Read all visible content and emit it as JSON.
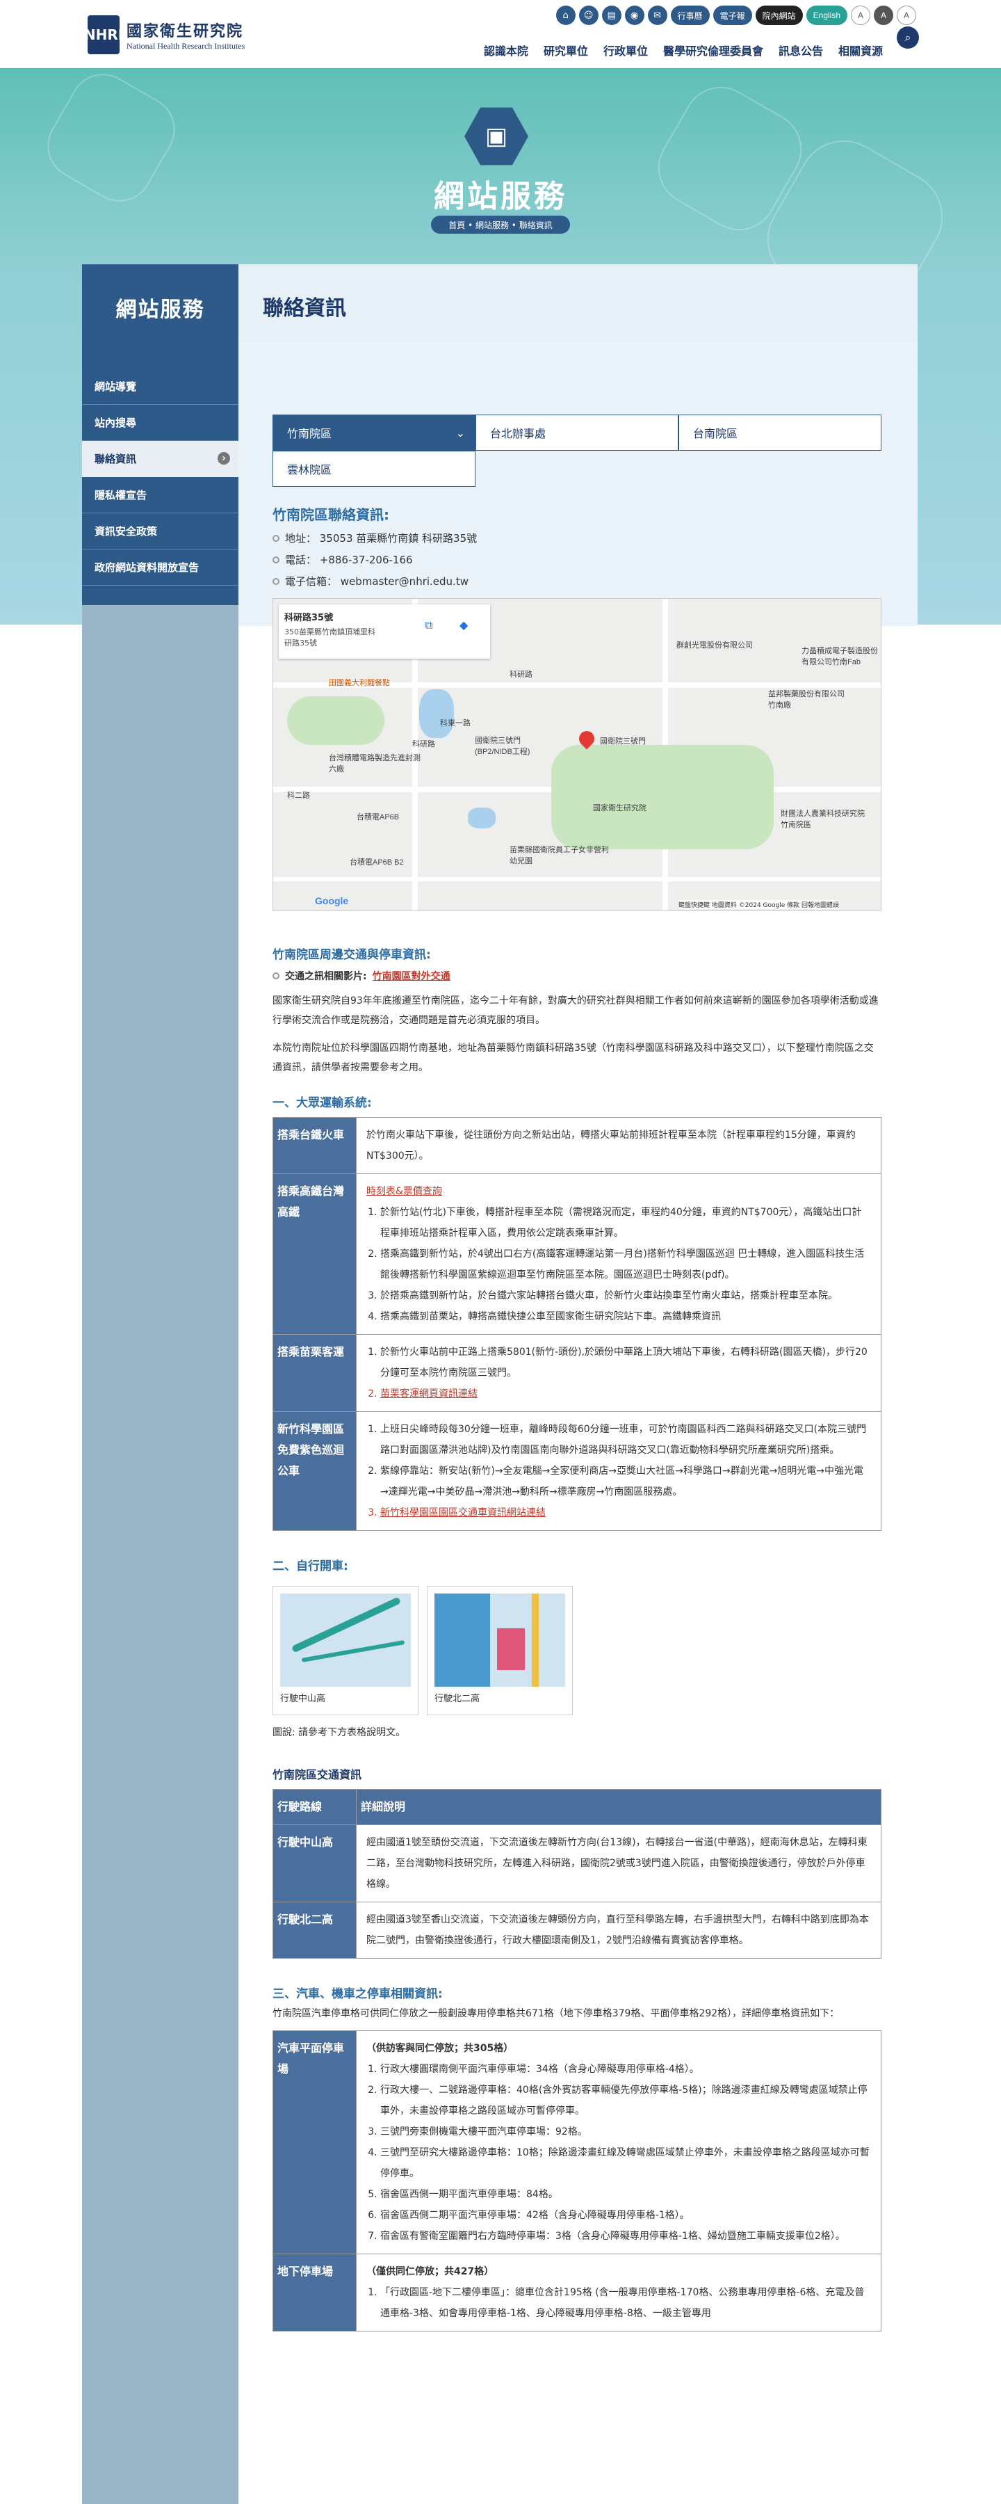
{
  "header": {
    "logo_mark": "NHRI",
    "org_zh": "國家衛生研究院",
    "org_en": "National Health Research Institutes",
    "util_icons": [
      "sitemap-icon",
      "people-icon",
      "book-icon",
      "location-icon",
      "mail-icon"
    ],
    "util_buttons": [
      "行事曆",
      "電子報",
      "院內網站",
      "English"
    ],
    "font_sizes": [
      "A",
      "A",
      "A"
    ],
    "nav": [
      "認識本院",
      "研究單位",
      "行政單位",
      "醫學研究倫理委員會",
      "訊息公告",
      "相關資源"
    ]
  },
  "hero": {
    "title": "網站服務",
    "breadcrumb": "首頁 • 網站服務 • 聯絡資訊"
  },
  "sidebar": {
    "title": "網站服務",
    "items": [
      "網站導覽",
      "站內搜尋",
      "聯絡資訊",
      "隱私權宣告",
      "資訊安全政策",
      "政府網站資料開放宣告"
    ]
  },
  "page_title": "聯絡資訊",
  "tabs": [
    "竹南院區",
    "台北辦事處",
    "台南院區",
    "雲林院區"
  ],
  "contact": {
    "heading": "竹南院區聯絡資訊:",
    "address": "地址： 35053 苗栗縣竹南鎮 科研路35號",
    "phone": "電話： +886-37-206-166",
    "email": "電子信箱： webmaster@nhri.edu.tw"
  },
  "map": {
    "card_title": "科研路35號",
    "card_addr": "350苗栗縣竹南鎮頂埔里科研路35號",
    "pois": [
      "群創光電股份有限公司",
      "力晶積成電子製造股份有限公司竹南Fab",
      "益邦製藥股份有限公司竹南廠",
      "國衛院三號門(BP2/NIDB工程)",
      "國衛院三號門",
      "科研路",
      "科研路",
      "台灣積體電路製造先進封測六廠",
      "台積電AP6B",
      "國家衛生研究院",
      "台積電AP6B B2",
      "苗栗縣國衛院員工子女非營利幼兒園",
      "財團法人農業科技研究院竹南院區",
      "田園義大利麵餐點",
      "科二路",
      "科東一路"
    ],
    "brand": "Google",
    "footer": "鍵盤快捷鍵 地圖資料 ©2024 Google 條款 回報地圖錯誤"
  },
  "traffic": {
    "heading": "竹南院區周邊交通與停車資訊:",
    "video_label": "交通之訊相關影片:",
    "video_link": "竹南園區對外交通",
    "p1": "國家衛生研究院自93年年底搬遷至竹南院區，迄今二十年有餘，對廣大的研究社群與相關工作者如何前來這嶄新的園區參加各項學術活動或進行學術交流合作或是院務洽，交通問題是首先必須克服的項目。",
    "p2": "本院竹南院址位於科學園區四期竹南基地，地址為苗栗縣竹南鎮科研路35號（竹南科學園區科研路及科中路交叉口），以下整理竹南院區之交通資訊，請供學者按需要參考之用。",
    "sec1": "一、大眾運輸系統:",
    "rows": [
      {
        "label": "搭乘台鐵火車",
        "text": "於竹南火車站下車後，從往頭份方向之新站出站，轉搭火車站前排班計程車至本院（計程車車程約15分鐘，車資約NT$300元）。"
      },
      {
        "label": "搭乘高鐵台灣高鐵",
        "link": "時刻表&票價查詢",
        "items": [
          "於新竹站(竹北)下車後，轉搭計程車至本院（需視路況而定，車程約40分鐘，車資約NT$700元），高鐵站出口計程車排班站搭乘計程車入區，費用依公定跳表乘車計算。",
          "搭乘高鐵到新竹站，於4號出口右方(高鐵客運轉運站第一月台)搭新竹科學園區巡迴 巴士轉線，進入園區科技生活館後轉搭新竹科學園區紫線巡迴車至竹南院區至本院。園區巡迴巴士時刻表(pdf)。",
          "於搭乘高鐵到新竹站，於台鐵六家站轉搭台鐵火車，於新竹火車站換車至竹南火車站，搭乘計程車至本院。",
          "搭乘高鐵到苗栗站，轉搭高鐵快捷公車至國家衛生研究院站下車。高鐵轉乘資訊"
        ]
      },
      {
        "label": "搭乘苗栗客運",
        "items": [
          "於新竹火車站前中正路上搭乘5801(新竹-頭份),於頭份中華路上頂大埔站下車後，右轉科研路(園區天橋)，步行20分鐘可至本院竹南院區三號門。",
          "苗栗客運網頁資訊連結"
        ]
      },
      {
        "label": "新竹科學園區免費紫色巡迴公車",
        "items": [
          "上班日尖峰時段每30分鐘一班車，離峰時段每60分鐘一班車，可於竹南園區科西二路與科研路交叉口(本院三號門路口對面園區滯洪池站牌)及竹南園區南向聯外道路與科研路交叉口(靠近動物科學研究所產業研究所)搭乘。",
          "紫線停靠站：新安站(新竹)→全友電腦→全家便利商店→亞獎山大社區→科學路口→群創光電→旭明光電→中強光電→達輝光電→中美矽晶→滯洪池→動科所→標準廠房→竹南園區服務處。",
          "新竹科學園區園區交通車資訊網站連結"
        ]
      }
    ],
    "sec2": "二、自行開車:",
    "bikes": [
      "行駛中山高",
      "行駛北二高"
    ],
    "caption": "圖說: 請參考下方表格說明文。",
    "route_title": "竹南院區交通資訊",
    "route_headers": [
      "行駛路線",
      "詳細說明"
    ],
    "routes": [
      {
        "label": "行駛中山高",
        "text": "經由國道1號至頭份交流道，下交流道後左轉新竹方向(台13線)，右轉接台一省道(中華路)，經南海休息站，左轉科東二路，至台灣動物科技研究所，左轉進入科研路，國衛院2號或3號門進入院區，由警衛換證後通行，停放於戶外停車格線。"
      },
      {
        "label": "行駛北二高",
        "text": "經由國道3號至香山交流道，下交流道後左轉頭份方向，直行至科學路左轉，右手邊拱型大門，右轉科中路到底即為本院二號門，由警衛換證後通行，行政大樓圍環南側及1，2號門沿線備有賣賓訪客停車格。"
      }
    ],
    "sec3": "三、汽車、機車之停車相關資訊:",
    "park_intro": "竹南院區汽車停車格可供同仁停放之一般劃設專用停車格共671格（地下停車格379格、平面停車格292格），詳細停車格資訊如下：",
    "parking": [
      {
        "label": "汽車平面停車場",
        "head": "（供訪客與同仁停放；共305格）",
        "items": [
          "行政大樓圓環南側平面汽車停車場：34格（含身心障礙專用停車格-4格）。",
          "行政大樓一、二號路邊停車格：40格(含外賓訪客車輛優先停放停車格-5格)；除路邊漆畫紅線及轉彎處區域禁止停車外，未畫設停車格之路段區域亦可暫停停車。",
          "三號門旁東側機電大樓平面汽車停車場：92格。",
          "三號門至研究大樓路邊停車格：10格；除路邊漆畫紅線及轉彎處區域禁止停車外，未畫設停車格之路段區域亦可暫停停車。",
          "宿舍區西側一期平面汽車停車場：84格。",
          "宿舍區西側二期平面汽車停車場：42格（含身心障礙專用停車格-1格）。",
          "宿舍區有警衛室圍籬門右方臨時停車場：3格（含身心障礙專用停車格-1格、婦幼暨施工車輛支援車位2格）。"
        ]
      },
      {
        "label": "地下停車場",
        "head": "（僅供同仁停放；共427格）",
        "items": [
          "「行政園區-地下二樓停車區」：總車位含計195格 (含一般專用停車格-170格、公務車專用停車格-6格、充電及普通車格-3格、如會專用停車格-1格、身心障礙專用停車格-8格、一級主管專用"
        ]
      }
    ]
  }
}
